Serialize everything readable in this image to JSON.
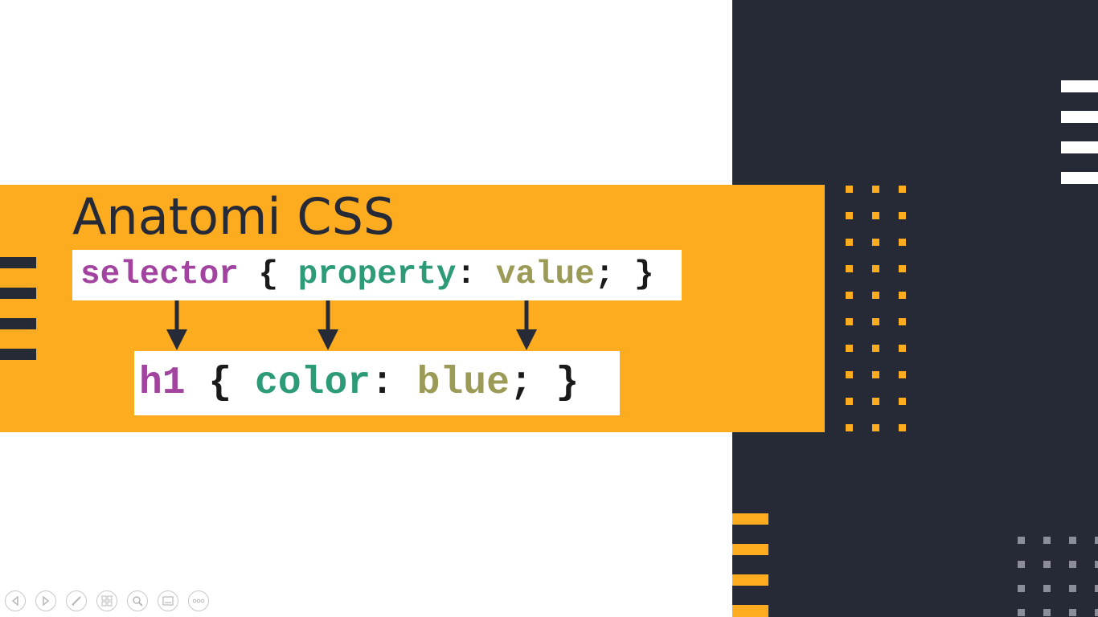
{
  "slide": {
    "title": "Anatomi CSS",
    "syntax": {
      "selector": "selector",
      "open": " { ",
      "property": "property",
      "colon": ": ",
      "value": "value",
      "close": "; }"
    },
    "example": {
      "selector": "h1",
      "open": " { ",
      "property": "color",
      "colon": ": ",
      "value": "blue",
      "close": "; }"
    }
  },
  "colors": {
    "accent": "#fdab1f",
    "dark": "#262936",
    "selector": "#a2449f",
    "property": "#2e9b78",
    "value": "#9b9a57"
  },
  "toolbar": {
    "icons": [
      "previous-icon",
      "next-icon",
      "pen-icon",
      "slides-icon",
      "zoom-icon",
      "subtitles-icon",
      "more-icon"
    ]
  }
}
